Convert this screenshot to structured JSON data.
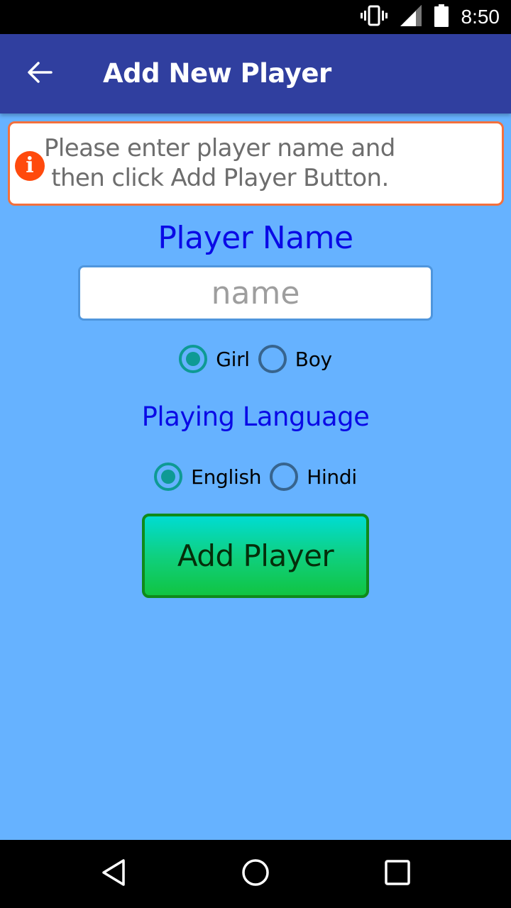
{
  "status_bar": {
    "time": "8:50",
    "icons": [
      "vibrate-icon",
      "signal-icon",
      "battery-icon"
    ]
  },
  "app_bar": {
    "back_icon": "arrow-left-icon",
    "title": "Add New Player"
  },
  "info_box": {
    "icon": "info-icon",
    "icon_glyph": "i",
    "text": "Please enter player name and\n then click Add Player Button."
  },
  "form": {
    "player_name_label": "Player Name",
    "name_input": {
      "value": "",
      "placeholder": "name"
    },
    "gender_options": [
      {
        "label": "Girl",
        "checked": true
      },
      {
        "label": "Boy",
        "checked": false
      }
    ],
    "language_label": "Playing Language",
    "language_options": [
      {
        "label": "English",
        "checked": true
      },
      {
        "label": "Hindi",
        "checked": false
      }
    ],
    "add_button_label": "Add Player"
  },
  "nav_bar": {
    "buttons": [
      "back-icon",
      "home-icon",
      "recents-icon"
    ]
  },
  "colors": {
    "app_bar": "#303f9f",
    "background": "#66b2ff",
    "info_border": "#f4703c",
    "info_icon": "#ff4a0d",
    "label_blue": "#0a0ae6",
    "radio_checked": "#0e9a94",
    "button_green": "#11c442"
  }
}
